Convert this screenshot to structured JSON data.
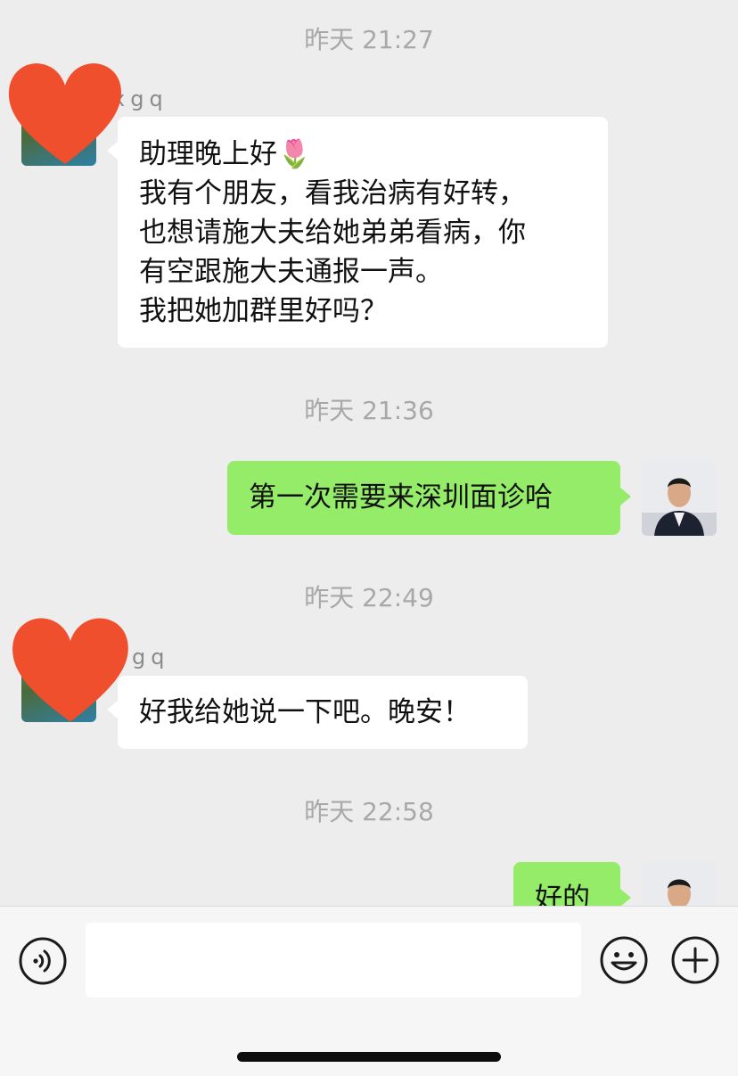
{
  "chat": {
    "timestamps": [
      "昨天 21:27",
      "昨天 21:36",
      "昨天 22:49",
      "昨天 22:58"
    ],
    "messages": [
      {
        "direction": "incoming",
        "sender": "xgq",
        "lines": [
          "助理晚上好🌷",
          "我有个朋友，看我治病有好转，",
          "也想请施大夫给她弟弟看病，你",
          "有空跟施大夫通报一声。",
          "我把她加群里好吗？"
        ]
      },
      {
        "direction": "outgoing",
        "text": "第一次需要来深圳面诊哈"
      },
      {
        "direction": "incoming",
        "sender": "gq",
        "text": "好我给她说一下吧。晚安！"
      },
      {
        "direction": "outgoing",
        "text": "好的"
      }
    ]
  },
  "input_bar": {
    "voice_icon": "voice-icon",
    "emoji_icon": "emoji-icon",
    "plus_icon": "plus-icon"
  },
  "colors": {
    "background": "#ededed",
    "incoming_bubble": "#ffffff",
    "outgoing_bubble": "#95ec69",
    "redaction": "#f04f2d"
  }
}
